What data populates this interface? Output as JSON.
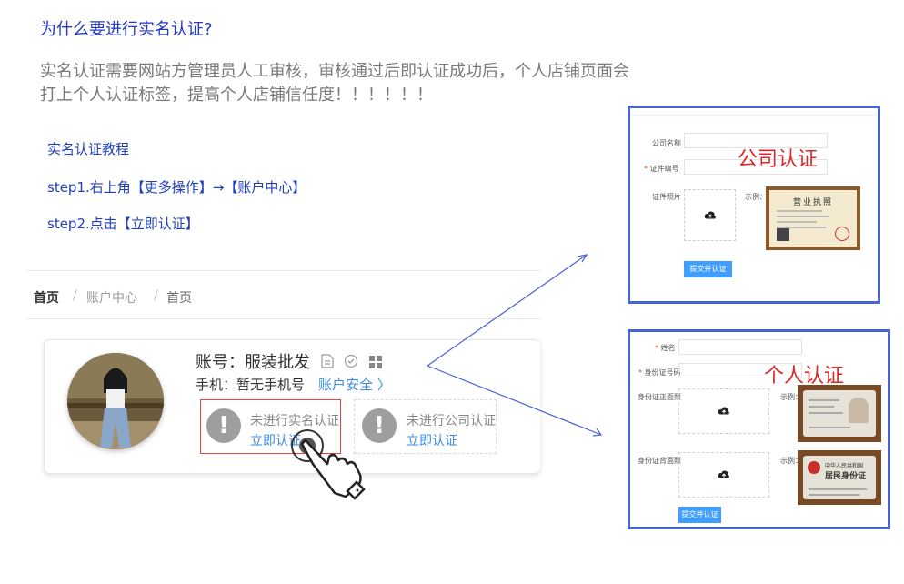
{
  "heading": "为什么要进行实名认证?",
  "intro": {
    "line1": "实名认证需要网站方管理员人工审核，审核通过后即认证成功后，个人店铺页面会",
    "line2": "打上个人认证标签，提高个人店铺信任度！！！！！！"
  },
  "tutorial": {
    "title": "实名认证教程",
    "step1": "step1.右上角【更多操作】→【账户中心】",
    "step2": "step2.点击【立即认证】"
  },
  "breadcrumb": {
    "home": "首页",
    "sep": "/",
    "account": "账户中心",
    "current": "首页"
  },
  "profile": {
    "account": "账号：服装批发",
    "phone": "手机：暂无手机号",
    "security": "账户安全 〉"
  },
  "verify": {
    "real_status": "未进行实名认证",
    "real_action": "立即认证",
    "company_status": "未进行公司认证",
    "company_action": "立即认证"
  },
  "company_panel": {
    "title": "公司认证",
    "name_label": "公司名称",
    "cert_label": "证件编号",
    "photo_label": "证件照片",
    "example_label": "示例：",
    "submit": "提交并认证",
    "license_text": "营业执照"
  },
  "personal_panel": {
    "title": "个人认证",
    "name_label": "姓名",
    "id_label": "身份证号码",
    "front_label": "身份证正面照",
    "back_label": "身份证背面照",
    "example_label": "示例：",
    "submit": "提交并认证",
    "id_back_line1": "中华人民共和国",
    "id_back_line2": "居民身份证"
  },
  "required_mark": "*",
  "colors": {
    "link": "#3a8ee6",
    "heading": "#2238c9",
    "panel_border": "#4a63d8",
    "highlight": "#e8463a",
    "big_label": "#d92b2b"
  }
}
